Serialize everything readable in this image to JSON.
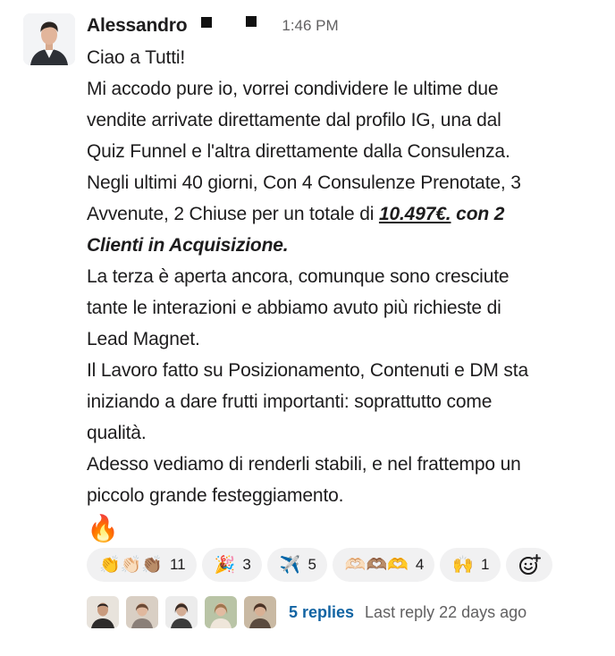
{
  "message": {
    "author": "Alessandro",
    "time": "1:46 PM",
    "avatar_icon": "user-avatar",
    "lines": [
      "Ciao a Tutti!",
      "Mi accodo pure io, vorrei condividere le ultime due",
      "vendite arrivate direttamente dal profilo IG, una dal",
      "Quiz Funnel e l'altra direttamente dalla Consulenza.",
      "Negli ultimi 40 giorni, Con 4 Consulenze Prenotate, 3"
    ],
    "line6_prefix": "Avvenute, 2 Chiuse per un totale di ",
    "amount": "10.497€.",
    "line6_suffix": " con 2",
    "line7": "Clienti in Acquisizione.",
    "lines_after": [
      "La terza è aperta ancora, comunque sono cresciute",
      "tante le interazioni e abbiamo avuto più richieste di",
      "Lead Magnet.",
      "Il Lavoro fatto su Posizionamento, Contenuti e DM sta",
      "iniziando a dare frutti importanti: soprattutto come",
      "qualità.",
      "Adesso vediamo di renderli stabili, e nel frattempo un",
      "piccolo grande festeggiamento."
    ],
    "trailing_emoji": "🔥"
  },
  "reactions": [
    {
      "emojis": "👏👏🏻👏🏽",
      "icons": "clap-icons",
      "count": "11"
    },
    {
      "emojis": "🎉",
      "icons": "party-popper-icon",
      "count": "3"
    },
    {
      "emojis": "✈️",
      "icons": "airplane-icon",
      "count": "5"
    },
    {
      "emojis": "🫶🏻🫶🏽🫶",
      "icons": "heart-hands-icons",
      "count": "4"
    },
    {
      "emojis": "🙌",
      "icons": "raised-hands-icon",
      "count": "1"
    }
  ],
  "add_reaction_icon": "add-reaction-icon",
  "thread": {
    "replies": "5 replies",
    "last_reply": "Last reply 22 days ago",
    "participant_count": 5
  },
  "colors": {
    "link": "#1264a3",
    "muted": "#616061",
    "pill_bg": "#f1f1f2",
    "text": "#1d1c1d"
  }
}
